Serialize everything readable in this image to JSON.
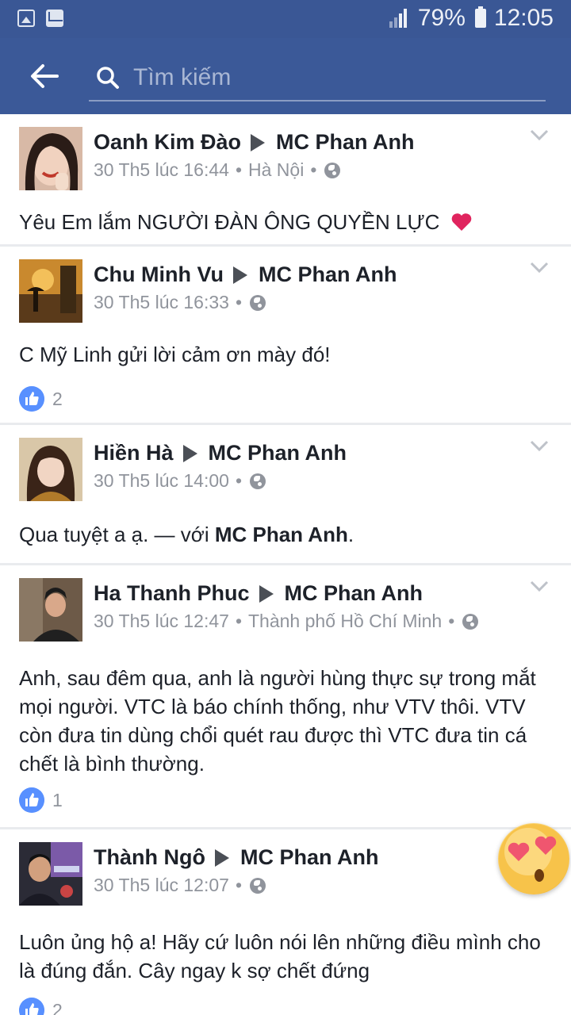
{
  "status_bar": {
    "battery": "79%",
    "time": "12:05"
  },
  "search": {
    "placeholder": "Tìm kiếm"
  },
  "posts": [
    {
      "author": "Oanh Kim Đào",
      "target": "MC Phan Anh",
      "timestamp": "30 Th5 lúc 16:44",
      "location": "Hà Nội",
      "text": "Yêu Em lắm NGƯỜI ĐÀN ÔNG QUYỀN LỰC",
      "likes": null
    },
    {
      "author": "Chu Minh Vu",
      "target": "MC Phan Anh",
      "timestamp": "30 Th5 lúc 16:33",
      "text": "C Mỹ Linh gửi lời cảm ơn mày đó!",
      "likes": "2"
    },
    {
      "author": "Hiền Hà",
      "target": "MC Phan Anh",
      "timestamp": "30 Th5 lúc 14:00",
      "text_prefix": "Qua tuyệt a ạ. — với ",
      "text_tag": "MC Phan Anh",
      "text_suffix": ".",
      "likes": null
    },
    {
      "author": "Ha Thanh Phuc",
      "target": "MC Phan Anh",
      "timestamp": "30 Th5 lúc 12:47",
      "location": "Thành phố Hồ Chí Minh",
      "text": "Anh, sau đêm qua, anh là người hùng thực sự trong mắt mọi người. VTC là báo chính thống, như VTV thôi. VTV còn đưa tin dùng chổi quét rau được thì VTC đưa tin cá chết là bình thường.",
      "likes": "1"
    },
    {
      "author": "Thành Ngô",
      "target": "MC Phan Anh",
      "timestamp": "30 Th5 lúc 12:07",
      "text": "Luôn ủng hộ a! Hãy cứ luôn nói lên những điều mình cho là đúng đắn. Cây ngay k sợ chết đứng",
      "likes": "2"
    }
  ],
  "colors": {
    "brand": "#3b5998",
    "like": "#5890ff"
  }
}
